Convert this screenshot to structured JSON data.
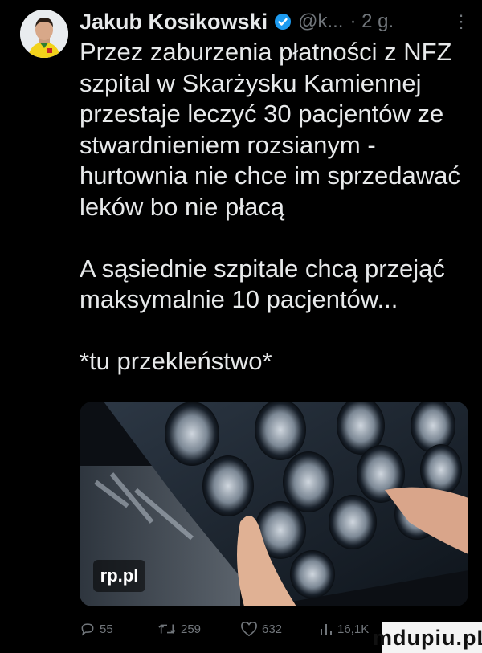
{
  "tweet": {
    "author_name": "Jakub Kosikowski",
    "handle": "@k...",
    "time": "· 2 g.",
    "more_label": "⋮",
    "text": "Przez zaburzenia płatności z NFZ\nszpital w Skarżysku Kamiennej\nprzestaje leczyć 30 pacjentów ze\nstwardnieniem rozsianym -\nhurtownia nie chce im sprzedawać\nleków bo nie płacą\n\nA sąsiednie szpitale chcą przejąć\nmaksymalnie 10 pacjentów...\n\n*tu przekleństwo*",
    "media": {
      "badge": "rp.pl"
    },
    "actions": {
      "replies": "55",
      "retweets": "259",
      "likes": "632",
      "views": "16,1K"
    }
  },
  "watermark": "mdupiu.pL",
  "colors": {
    "background": "#000000",
    "text": "#e7e9ea",
    "muted": "#71767b",
    "verified": "#1d9bf0"
  }
}
